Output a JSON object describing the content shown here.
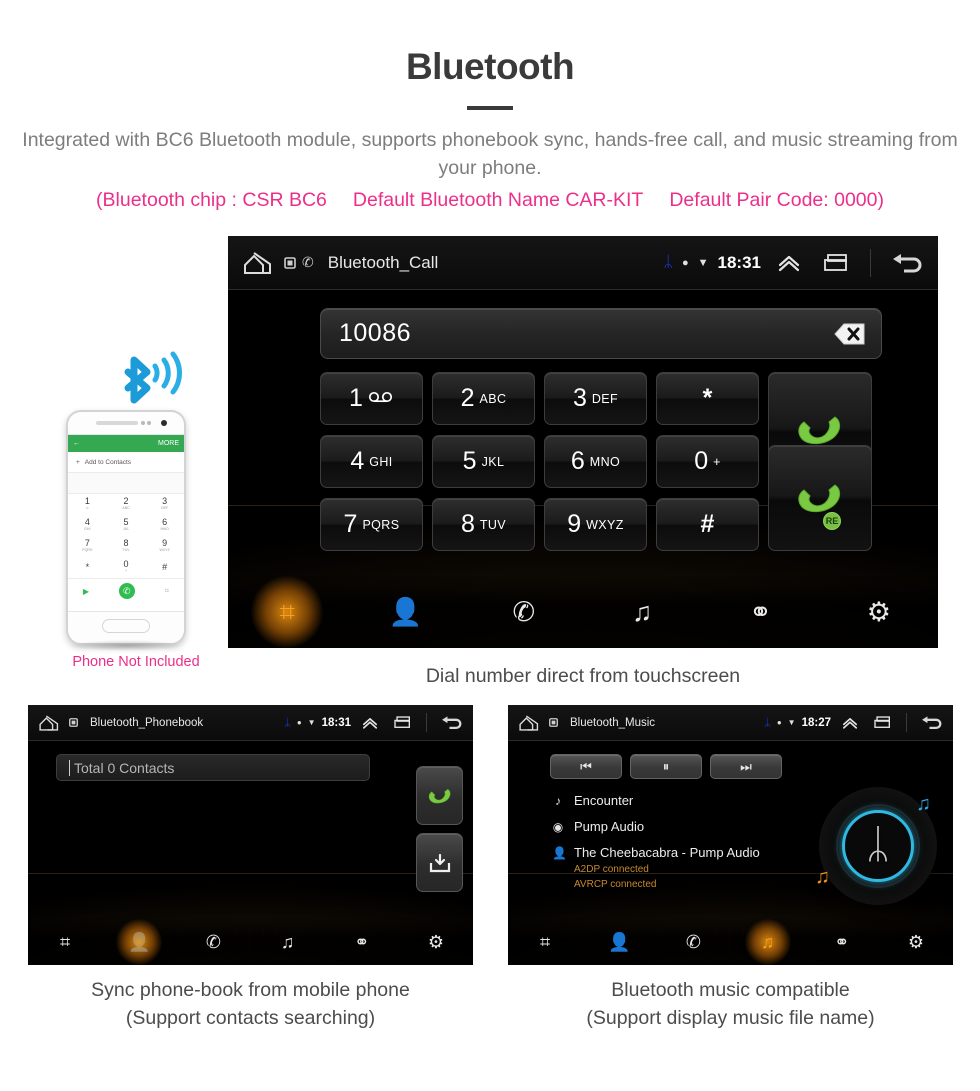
{
  "header": {
    "title": "Bluetooth",
    "subtitle": "Integrated with BC6 Bluetooth module, supports phonebook sync, hands-free call, and music streaming from your phone.",
    "spec_chip": "(Bluetooth chip : CSR BC6",
    "spec_name": "Default Bluetooth Name CAR-KIT",
    "spec_pair": "Default Pair Code: 0000)",
    "accent_pink": "#ec2f8a",
    "text_gray": "#7d7d7d"
  },
  "phone_illustration": {
    "appbar_back": "←",
    "appbar_more": "MORE",
    "add_contact_plus": "+",
    "add_contact_label": "Add to Contacts",
    "keys": [
      {
        "d": "1",
        "s": "∞"
      },
      {
        "d": "2",
        "s": "ABC"
      },
      {
        "d": "3",
        "s": "DEF"
      },
      {
        "d": "4",
        "s": "GHI"
      },
      {
        "d": "5",
        "s": "JKL"
      },
      {
        "d": "6",
        "s": "MNO"
      },
      {
        "d": "7",
        "s": "PQRS"
      },
      {
        "d": "8",
        "s": "TUV"
      },
      {
        "d": "9",
        "s": "WXYZ"
      },
      {
        "d": "*",
        "s": ""
      },
      {
        "d": "0",
        "s": "+"
      },
      {
        "d": "#",
        "s": ""
      }
    ],
    "video_call_icon": "▶",
    "call_icon": "✆",
    "keypad_icon": "⌗",
    "not_included_label": "Phone Not Included"
  },
  "main_screen": {
    "status": {
      "home_icon": "home-icon",
      "sd_icon": "sd-card-icon",
      "phone_icon": "✆",
      "title": "Bluetooth_Call",
      "bluetooth_icon": "ᛦ",
      "mute_icon": "●",
      "wifi_icon": "▼",
      "clock": "18:31",
      "chevron_up_icon": "❯",
      "recents_icon": "recents-icon",
      "back_icon": "back-icon"
    },
    "dial": {
      "number": "10086",
      "backspace_icon": "backspace-icon",
      "keys": [
        {
          "digit": "1",
          "sub": "∞",
          "name": "key-1"
        },
        {
          "digit": "2",
          "sub": "ABC",
          "name": "key-2"
        },
        {
          "digit": "3",
          "sub": "DEF",
          "name": "key-3"
        },
        {
          "digit": "*",
          "sub": "",
          "name": "key-star"
        },
        {
          "digit": "4",
          "sub": "GHI",
          "name": "key-4"
        },
        {
          "digit": "5",
          "sub": "JKL",
          "name": "key-5"
        },
        {
          "digit": "6",
          "sub": "MNO",
          "name": "key-6"
        },
        {
          "digit": "0",
          "sub": "+",
          "name": "key-0"
        },
        {
          "digit": "7",
          "sub": "PQRS",
          "name": "key-7"
        },
        {
          "digit": "8",
          "sub": "TUV",
          "name": "key-8"
        },
        {
          "digit": "9",
          "sub": "WXYZ",
          "name": "key-9"
        },
        {
          "digit": "#",
          "sub": "",
          "name": "key-hash"
        }
      ],
      "call_button_icon": "call-handset-icon",
      "redial_button_icon": "redial-handset-icon",
      "redial_badge": "RE"
    },
    "nav": [
      {
        "name": "nav-keypad",
        "icon": "⌗",
        "active": true
      },
      {
        "name": "nav-contacts",
        "icon": "👤",
        "active": false
      },
      {
        "name": "nav-call-log",
        "icon": "✆",
        "active": false
      },
      {
        "name": "nav-music",
        "icon": "♫",
        "active": false
      },
      {
        "name": "nav-link",
        "icon": "⚭",
        "active": false
      },
      {
        "name": "nav-settings",
        "icon": "⚙",
        "active": false
      }
    ],
    "caption": "Dial number direct from touchscreen"
  },
  "phonebook_screen": {
    "status": {
      "title": "Bluetooth_Phonebook",
      "clock": "18:31"
    },
    "search_placeholder": "Total 0 Contacts",
    "call_button_icon": "call-handset-icon",
    "download_button_icon": "download-contacts-icon",
    "nav": [
      {
        "name": "nav-keypad",
        "icon": "⌗",
        "active": false
      },
      {
        "name": "nav-contacts",
        "icon": "👤",
        "active": true
      },
      {
        "name": "nav-call-log",
        "icon": "✆",
        "active": false
      },
      {
        "name": "nav-music",
        "icon": "♫",
        "active": false
      },
      {
        "name": "nav-link",
        "icon": "⚭",
        "active": false
      },
      {
        "name": "nav-settings",
        "icon": "⚙",
        "active": false
      }
    ],
    "caption": "Sync phone-book from mobile phone\n(Support contacts searching)"
  },
  "music_screen": {
    "status": {
      "title": "Bluetooth_Music",
      "clock": "18:27"
    },
    "controls": [
      {
        "name": "previous-track-button",
        "icon": "⏮"
      },
      {
        "name": "pause-button",
        "icon": "⏸"
      },
      {
        "name": "next-track-button",
        "icon": "⏭"
      }
    ],
    "track": {
      "title_icon": "♪",
      "title": "Encounter",
      "album_icon": "◉",
      "album": "Pump Audio",
      "artist_icon": "👤",
      "artist": "The Cheebacabra - Pump Audio",
      "status_a2dp": "A2DP connected",
      "status_avrcp": "AVRCP connected",
      "status_color": "#c78a2a"
    },
    "album_art": {
      "bluetooth_glyph": "ᛦ",
      "note_blue": "♫",
      "note_orange": "♫",
      "ring_color": "#2fb8e0"
    },
    "nav": [
      {
        "name": "nav-keypad",
        "icon": "⌗",
        "active": false
      },
      {
        "name": "nav-contacts",
        "icon": "👤",
        "active": false
      },
      {
        "name": "nav-call-log",
        "icon": "✆",
        "active": false
      },
      {
        "name": "nav-music",
        "icon": "♫",
        "active": true
      },
      {
        "name": "nav-link",
        "icon": "⚭",
        "active": false
      },
      {
        "name": "nav-settings",
        "icon": "⚙",
        "active": false
      }
    ],
    "caption": "Bluetooth music compatible\n(Support display music file name)"
  }
}
